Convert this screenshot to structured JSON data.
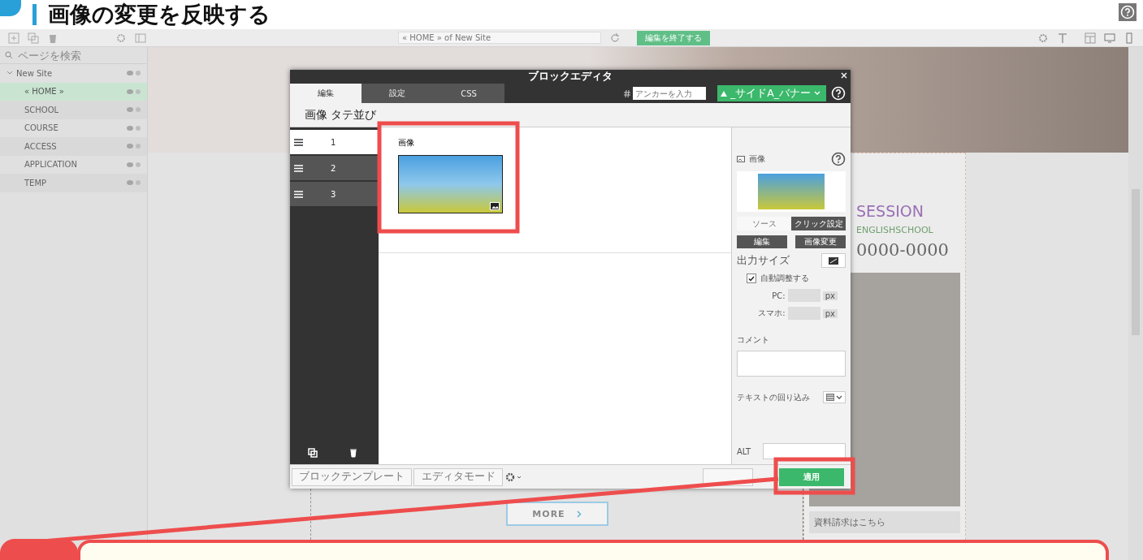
{
  "heading": {
    "text": "画像の変更を反映する"
  },
  "toolbar": {
    "breadcrumb": "« HOME » of New Site",
    "finish_button": "編集を終了する"
  },
  "sidebar": {
    "search": {
      "placeholder": "ページを検索"
    },
    "tree": [
      {
        "label": "New Site",
        "expanded": true,
        "selected": false,
        "children": [
          {
            "label": "« HOME »",
            "selected": true
          },
          {
            "label": "SCHOOL",
            "selected": false
          },
          {
            "label": "COURSE",
            "selected": false
          },
          {
            "label": "ACCESS",
            "selected": false
          },
          {
            "label": "APPLICATION",
            "selected": false
          },
          {
            "label": "TEMP",
            "selected": false
          }
        ]
      }
    ]
  },
  "canvas": {
    "more_button": "MORE",
    "logo_title": "SESSION",
    "logo_subtitle": "ENGLISHSCHOOL",
    "phone": "0000-0000",
    "request_link": "資料請求はこちら"
  },
  "dialog": {
    "title": "ブロックエディタ",
    "tabs": [
      {
        "label": "編集",
        "selected": true
      },
      {
        "label": "設定",
        "selected": false
      },
      {
        "label": "CSS",
        "selected": false
      }
    ],
    "anchor": {
      "placeholder": "アンカーを入力"
    },
    "banner_select": "_サイドA_バナー",
    "block_title": "画像 タテ並び",
    "items": [
      {
        "label": "1",
        "selected": true
      },
      {
        "label": "2",
        "selected": false
      },
      {
        "label": "3",
        "selected": false
      }
    ],
    "content_label": "画像",
    "panel": {
      "title": "画像",
      "source_tabs": [
        {
          "label": "ソース",
          "selected": true
        },
        {
          "label": "クリック設定",
          "selected": false
        }
      ],
      "buttons": [
        "編集",
        "画像変更"
      ],
      "output_size_label": "出力サイズ",
      "auto_adjust": {
        "label": "自動調整する",
        "checked": true
      },
      "sizes": [
        {
          "label": "PC:",
          "unit": "px"
        },
        {
          "label": "スマホ:",
          "unit": "px"
        }
      ],
      "comment_label": "コメント",
      "wrap_label": "テキストの回り込み",
      "alt_label": "ALT"
    },
    "footer": {
      "template_button": "ブロックテンプレート",
      "mode_button": "エディタモード",
      "apply_button": "適用"
    }
  }
}
